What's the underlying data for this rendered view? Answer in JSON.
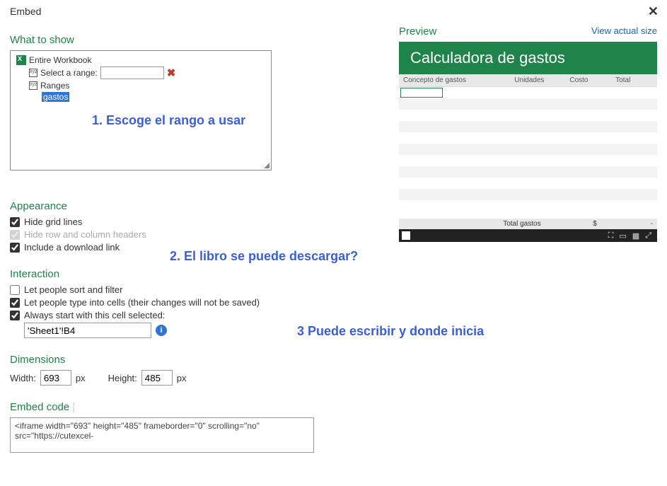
{
  "dialog": {
    "title": "Embed"
  },
  "what": {
    "heading": "What to show",
    "workbook": "Entire Workbook",
    "selectRangeLabel": "Select a range:",
    "rangesLabel": "Ranges",
    "selectedRange": "gastos"
  },
  "annot": {
    "a1": "1. Escoge el rango a usar",
    "a2": "2. El libro se puede descargar?",
    "a3": "3 Puede escribir y donde inicia"
  },
  "appearance": {
    "heading": "Appearance",
    "hideGrid": "Hide grid lines",
    "hideHeaders": "Hide row and column headers",
    "downloadLink": "Include a download link"
  },
  "interaction": {
    "heading": "Interaction",
    "sortFilter": "Let people sort and filter",
    "typeCells": "Let people type into cells (their changes will not be saved)",
    "startCell": "Always start with this cell selected:",
    "cellRef": "'Sheet1'!B4"
  },
  "dimensions": {
    "heading": "Dimensions",
    "widthLabel": "Width:",
    "widthVal": "693",
    "heightLabel": "Height:",
    "heightVal": "485",
    "px": "px"
  },
  "embed": {
    "heading": "Embed code",
    "code": "<iframe width=\"693\" height=\"485\" frameborder=\"0\" scrolling=\"no\" src=\"https://cutexcel-"
  },
  "preview": {
    "heading": "Preview",
    "viewActual": "View actual size",
    "banner": "Calculadora de gastos",
    "cols": {
      "a": "Concepto de gastos",
      "b": "Unidades",
      "c": "Costo",
      "d": "Total"
    },
    "totalLabel": "Total gastos",
    "currency": "$",
    "dash": "-"
  }
}
